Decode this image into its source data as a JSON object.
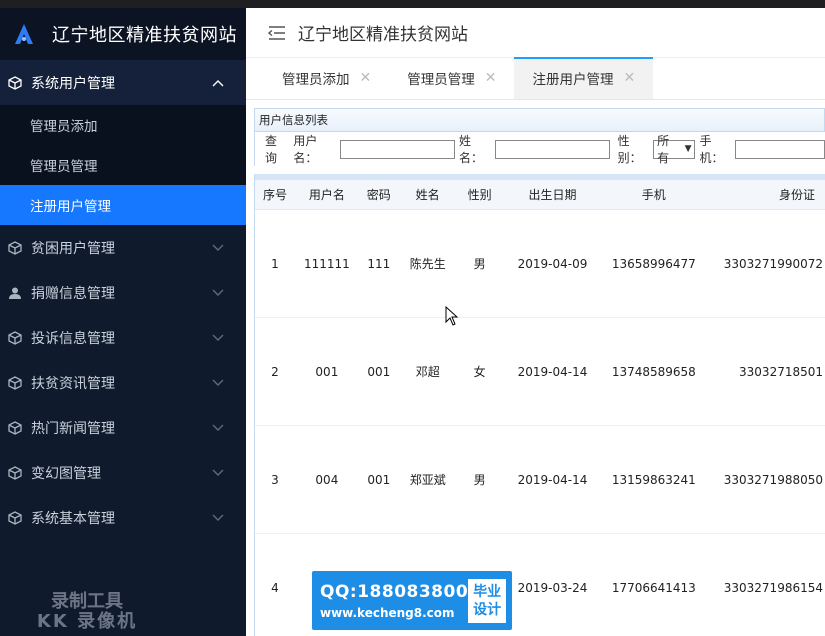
{
  "app": {
    "brand_title": "辽宁地区精准扶贫网站",
    "header_title": "辽宁地区精准扶贫网站"
  },
  "sidebar": {
    "groups": [
      {
        "label": "系统用户管理",
        "icon": "cube-icon",
        "open": true,
        "items": [
          {
            "label": "管理员添加",
            "active": false
          },
          {
            "label": "管理员管理",
            "active": false
          },
          {
            "label": "注册用户管理",
            "active": true
          }
        ]
      },
      {
        "label": "贫困用户管理",
        "icon": "cube-icon"
      },
      {
        "label": "捐赠信息管理",
        "icon": "user-icon"
      },
      {
        "label": "投诉信息管理",
        "icon": "cube-icon"
      },
      {
        "label": "扶贫资讯管理",
        "icon": "cube-icon"
      },
      {
        "label": "热门新闻管理",
        "icon": "cube-icon"
      },
      {
        "label": "变幻图管理",
        "icon": "cube-icon"
      },
      {
        "label": "系统基本管理",
        "icon": "cube-icon"
      }
    ],
    "watermark_l1": "录制工具",
    "watermark_l2": "KK 录像机"
  },
  "tabs": [
    {
      "label": "管理员添加",
      "active": false
    },
    {
      "label": "管理员管理",
      "active": false
    },
    {
      "label": "注册用户管理",
      "active": true
    }
  ],
  "panel": {
    "title": "用户信息列表",
    "query_label": "查询",
    "username_label": "用户名：",
    "name_label": "姓名：",
    "gender_label": "性别：",
    "gender_value": "所有",
    "phone_label": "手机："
  },
  "table": {
    "headers": [
      "序号",
      "用户名",
      "密码",
      "姓名",
      "性别",
      "出生日期",
      "手机",
      "身份证"
    ],
    "rows": [
      [
        "1",
        "111111",
        "111",
        "陈先生",
        "男",
        "2019-04-09",
        "13658996477",
        "3303271990072"
      ],
      [
        "2",
        "001",
        "001",
        "邓超",
        "女",
        "2019-04-14",
        "13748589658",
        "33032718501"
      ],
      [
        "3",
        "004",
        "001",
        "郑亚斌",
        "男",
        "2019-04-14",
        "13159863241",
        "3303271988050"
      ],
      [
        "4",
        "",
        "",
        "",
        "",
        "2019-03-24",
        "17706641413",
        "3303271986154"
      ]
    ]
  },
  "promo": {
    "qq": "QQ:188083800",
    "url": "www.kecheng8.com",
    "box_l1": "毕业",
    "box_l2": "设计"
  },
  "colors": {
    "sidebar_bg": "#0f1a2c",
    "active_item": "#1677ff",
    "tab_indicator": "#1e9fff",
    "promo_bg": "#1e8de6"
  }
}
